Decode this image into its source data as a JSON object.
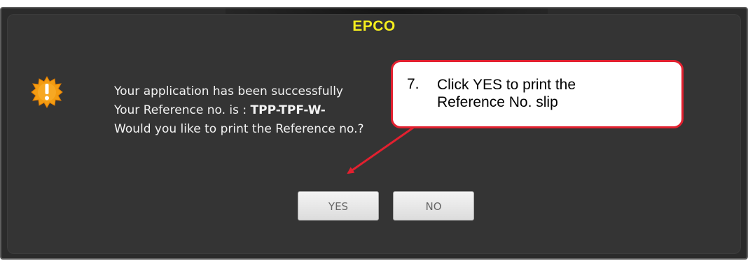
{
  "dialog": {
    "title": "EPCO",
    "icon": "warning-burst-icon",
    "message_line1": "Your application has been successfully",
    "message_line2_prefix": "Your Reference no. is : ",
    "message_line2_value": "TPP-TPF-W-",
    "message_line3": "Would you like to print the Reference no.?",
    "yes_label": "YES",
    "no_label": "NO"
  },
  "annotation": {
    "step_number": "7.",
    "line1": "Click YES to print the",
    "line2": "Reference No. slip",
    "border_color": "#e2202f",
    "arrow_color": "#e2202f"
  },
  "colors": {
    "dialog_background": "#343434",
    "title_color": "#f5ee1e",
    "icon_color": "#f39c12"
  }
}
